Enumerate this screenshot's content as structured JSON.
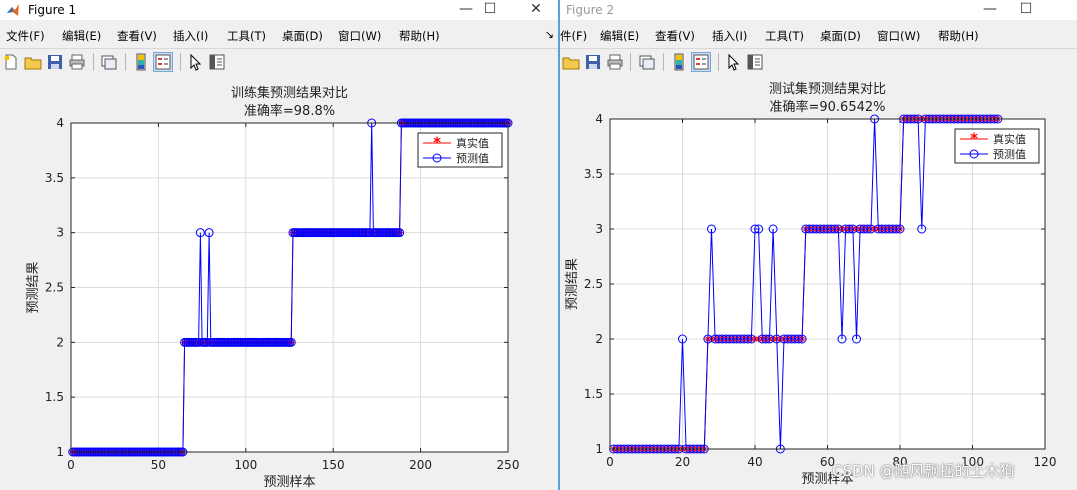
{
  "watermark": "CSDN @随风飘摇的土木狗",
  "window1": {
    "title": "Figure 1",
    "controls": {
      "minimize": "—",
      "maximize": "☐",
      "close": "✕"
    },
    "menu": [
      "文件(F)",
      "编辑(E)",
      "查看(V)",
      "插入(I)",
      "工具(T)",
      "桌面(D)",
      "窗口(W)",
      "帮助(H)"
    ],
    "menu_overflow": "↘"
  },
  "window2": {
    "title": "Figure 2",
    "controls": {
      "minimize": "—",
      "maximize": "☐"
    },
    "menu": [
      "件(F)",
      "编辑(E)",
      "查看(V)",
      "插入(I)",
      "工具(T)",
      "桌面(D)",
      "窗口(W)",
      "帮助(H)"
    ]
  },
  "toolbar_icons": [
    "new-figure-icon",
    "open-folder-icon",
    "save-icon",
    "print-icon",
    "link-icon",
    "colorbar-icon",
    "legend-icon",
    "pointer-icon",
    "property-editor-icon"
  ],
  "colors": {
    "true_series": "#ff0000",
    "pred_series": "#0000ff",
    "axes_bg": "#ffffff",
    "grid": "#dcdcdc"
  },
  "chart_data": [
    {
      "type": "line",
      "title": "训练集预测结果对比",
      "subtitle": "准确率=98.8%",
      "xlabel": "预测样本",
      "ylabel": "预测结果",
      "xlim": [
        0,
        250
      ],
      "ylim": [
        1,
        4
      ],
      "xticks": [
        "0",
        "50",
        "100",
        "150",
        "200",
        "250"
      ],
      "yticks": [
        "1",
        "1.5",
        "2",
        "2.5",
        "3",
        "3.5",
        "4"
      ],
      "grid": true,
      "legend_position": "top-right",
      "legend": [
        "真实值",
        "预测值"
      ],
      "n_samples": 250,
      "true_segments": [
        {
          "from": 1,
          "to": 64,
          "class": 1
        },
        {
          "from": 65,
          "to": 126,
          "class": 2
        },
        {
          "from": 127,
          "to": 188,
          "class": 3
        },
        {
          "from": 189,
          "to": 250,
          "class": 4
        }
      ],
      "pred_overrides": [
        {
          "x": 74,
          "y": 3
        },
        {
          "x": 79,
          "y": 3
        },
        {
          "x": 172,
          "y": 4
        }
      ]
    },
    {
      "type": "line",
      "title": "测试集预测结果对比",
      "subtitle": "准确率=90.6542%",
      "xlabel": "预测样本",
      "ylabel": "预测结果",
      "xlim": [
        0,
        120
      ],
      "ylim": [
        1,
        4
      ],
      "xticks": [
        "0",
        "20",
        "40",
        "60",
        "80",
        "100",
        "120"
      ],
      "yticks": [
        "1",
        "1.5",
        "2",
        "2.5",
        "3",
        "3.5",
        "4"
      ],
      "grid": true,
      "legend_position": "top-right",
      "legend": [
        "真实值",
        "预测值"
      ],
      "n_samples": 107,
      "true_segments": [
        {
          "from": 1,
          "to": 26,
          "class": 1
        },
        {
          "from": 27,
          "to": 53,
          "class": 2
        },
        {
          "from": 54,
          "to": 80,
          "class": 3
        },
        {
          "from": 81,
          "to": 107,
          "class": 4
        }
      ],
      "pred_overrides": [
        {
          "x": 20,
          "y": 2
        },
        {
          "x": 28,
          "y": 3
        },
        {
          "x": 40,
          "y": 3
        },
        {
          "x": 41,
          "y": 3
        },
        {
          "x": 45,
          "y": 3
        },
        {
          "x": 47,
          "y": 1
        },
        {
          "x": 64,
          "y": 2
        },
        {
          "x": 68,
          "y": 2
        },
        {
          "x": 73,
          "y": 4
        },
        {
          "x": 86,
          "y": 3
        }
      ]
    }
  ]
}
